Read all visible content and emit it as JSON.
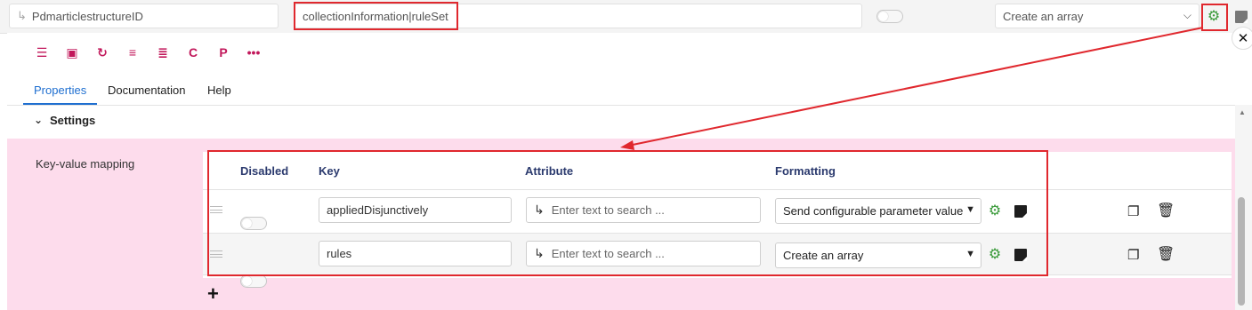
{
  "topbar": {
    "field1": "PdmarticlestructureID",
    "field2": "collectionInformation|ruleSet",
    "select": "Create an array"
  },
  "toolbar": {
    "icons": [
      "tree-icon",
      "save-icon",
      "undo-icon",
      "database-export-icon",
      "database-import-icon",
      "clipboard-c-icon",
      "clipboard-p-icon",
      "more-icon"
    ]
  },
  "tabs": [
    "Properties",
    "Documentation",
    "Help"
  ],
  "settings": {
    "label": "Settings"
  },
  "mapping": {
    "label": "Key-value mapping",
    "headers": {
      "disabled": "Disabled",
      "key": "Key",
      "attribute": "Attribute",
      "formatting": "Formatting"
    },
    "rows": [
      {
        "key": "appliedDisjunctively",
        "attribute_placeholder": "Enter text to search ...",
        "formatting": "Send configurable parameter value"
      },
      {
        "key": "rules",
        "attribute_placeholder": "Enter text to search ...",
        "formatting": "Create an array"
      }
    ],
    "add": "+"
  },
  "colors": {
    "accent": "#1f6fd0",
    "icon": "#c2185b",
    "highlight": "#e0282e",
    "pink": "#fddcec",
    "gear": "#3a9a3a"
  }
}
